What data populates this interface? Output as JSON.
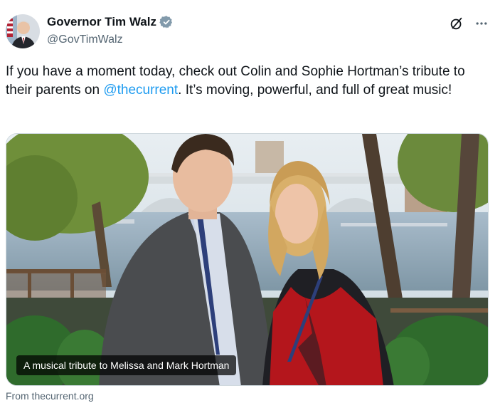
{
  "author": {
    "display_name": "Governor Tim Walz",
    "handle": "@GovTimWalz",
    "verified_color": "#829aab"
  },
  "actions": {
    "grok_icon": "grok-icon",
    "more_icon": "more-icon"
  },
  "tweet": {
    "text_before": "If you have a moment today, check out Colin and Sophie Hortman’s tribute to their parents on ",
    "mention": "@thecurrent",
    "text_after": ". It’s moving, powerful, and full of great music!"
  },
  "card": {
    "caption": "A musical tribute to Melissa and Mark Hortman",
    "source": "From thecurrent.org"
  },
  "colors": {
    "link": "#1d9bf0",
    "secondary_text": "#536471",
    "primary_text": "#0f1419"
  }
}
